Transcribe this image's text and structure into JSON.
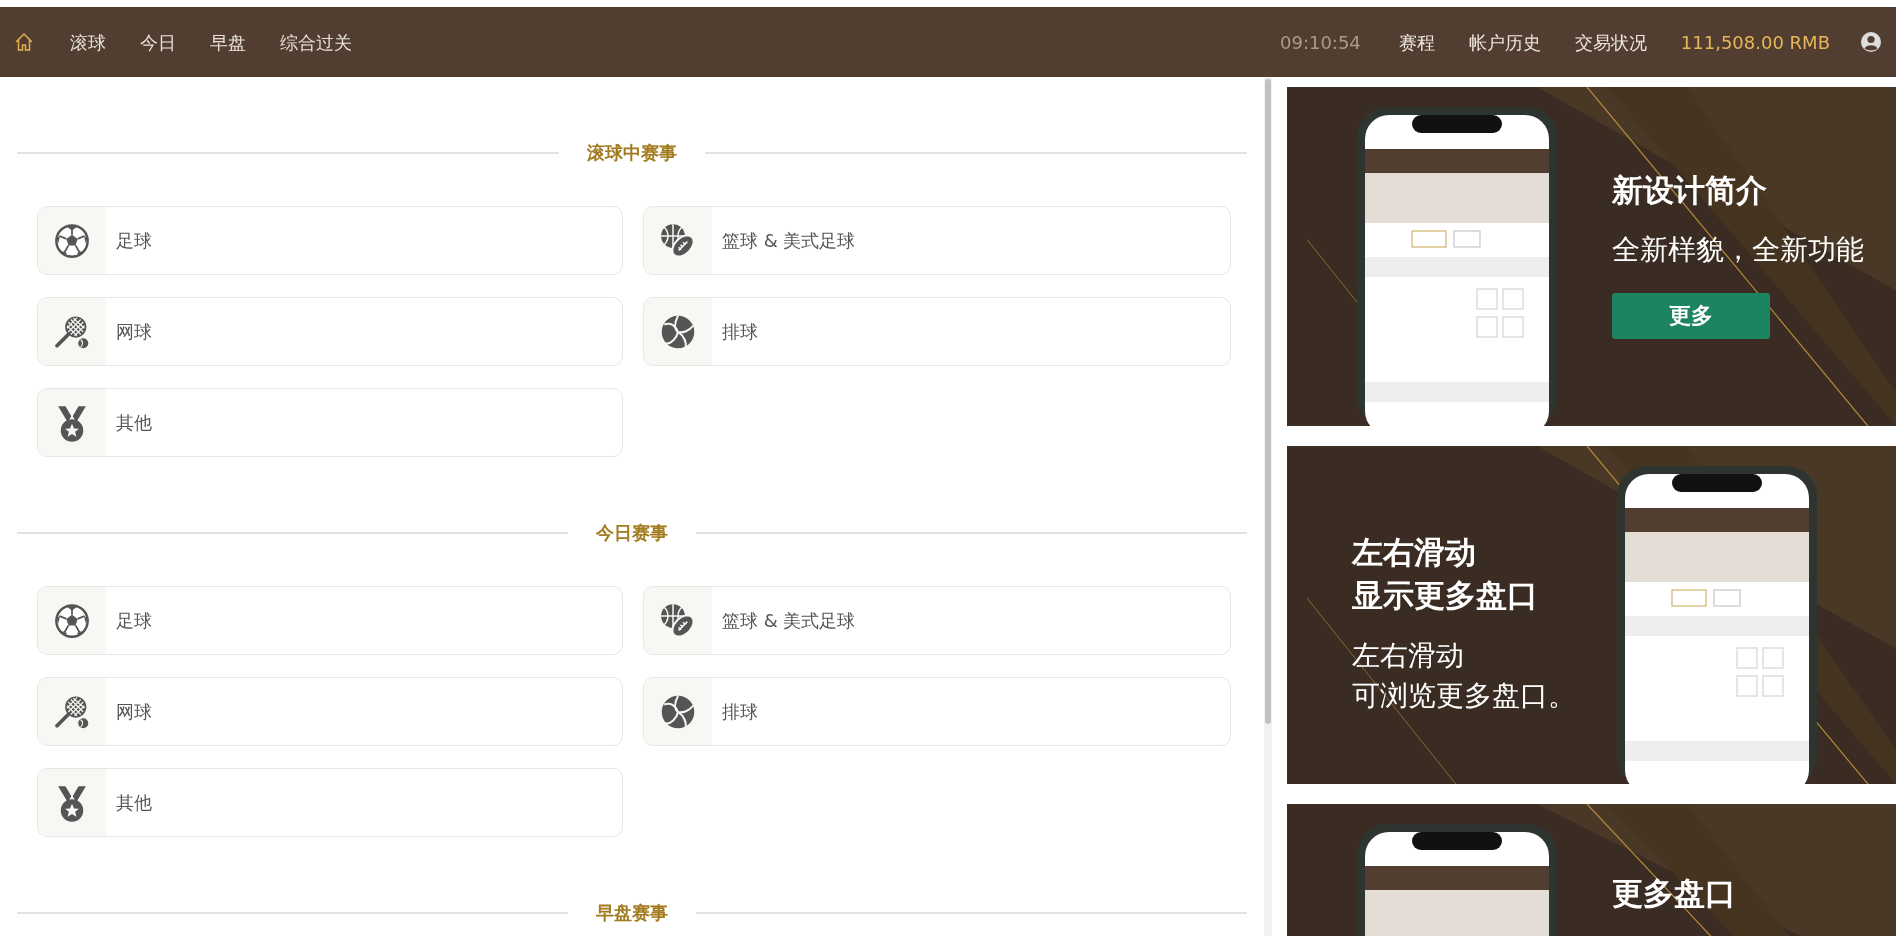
{
  "navbar": {
    "home": {
      "selected": true
    },
    "tabs": [
      {
        "label": "滚球",
        "selected": false
      },
      {
        "label": "今日",
        "selected": false
      },
      {
        "label": "早盘",
        "selected": false
      },
      {
        "label": "综合过关",
        "selected": false
      }
    ],
    "time": "09:10:54",
    "links": [
      "赛程",
      "帐户历史",
      "交易状况"
    ],
    "balance": "111,508.00 RMB"
  },
  "sections": [
    {
      "title": "滚球中赛事",
      "items": [
        {
          "label": "足球",
          "kind": "soccer"
        },
        {
          "label": "篮球 & 美式足球",
          "kind": "basketball"
        },
        {
          "label": "网球",
          "kind": "tennis"
        },
        {
          "label": "排球",
          "kind": "volleyball"
        },
        {
          "label": "其他",
          "kind": "other"
        }
      ]
    },
    {
      "title": "今日赛事",
      "items": [
        {
          "label": "足球",
          "kind": "soccer"
        },
        {
          "label": "篮球 & 美式足球",
          "kind": "basketball"
        },
        {
          "label": "网球",
          "kind": "tennis"
        },
        {
          "label": "排球",
          "kind": "volleyball"
        },
        {
          "label": "其他",
          "kind": "other"
        }
      ]
    },
    {
      "title": "早盘赛事"
    }
  ],
  "banners": [
    {
      "kind": "phone-left",
      "title": [
        "新设计简介"
      ],
      "subtitle": [
        "全新样貌，全新功能"
      ],
      "button": "更多"
    },
    {
      "kind": "phone-right",
      "title": [
        "左右滑动",
        "显示更多盘口"
      ],
      "subtitle": [
        "左右滑动",
        "可浏览更多盘口。"
      ]
    },
    {
      "kind": "phone-left",
      "title": [
        "更多盘口"
      ]
    }
  ]
}
